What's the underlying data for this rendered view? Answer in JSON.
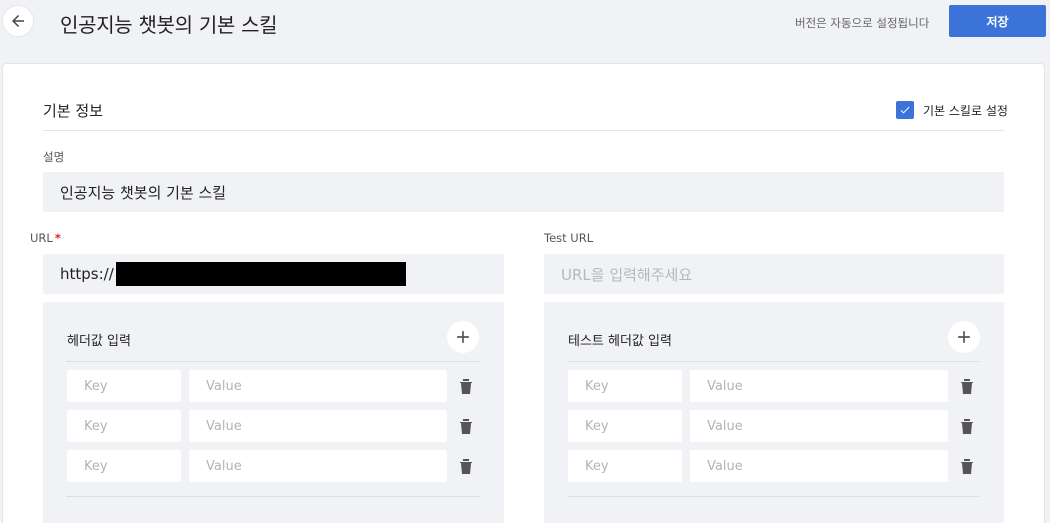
{
  "header": {
    "title": "인공지능 챗봇의 기본 스킬",
    "autosave_note": "버전은 자동으로 설정됩니다",
    "save_label": "저장"
  },
  "basic_info": {
    "section_title": "기본 정보",
    "default_skill_label": "기본 스킬로 설정",
    "default_skill_checked": true,
    "description_label": "설명",
    "description_value": "인공지능 챗봇의 기본 스킬"
  },
  "url": {
    "label": "URL",
    "required_mark": "*",
    "value": "https://"
  },
  "test_url": {
    "label": "Test URL",
    "placeholder": "URL을 입력해주세요"
  },
  "headers": {
    "title": "헤더값 입력",
    "key_placeholder": "Key",
    "value_placeholder": "Value",
    "rows": 3
  },
  "test_headers": {
    "title": "테스트 헤더값 입력",
    "key_placeholder": "Key",
    "value_placeholder": "Value",
    "rows": 3
  },
  "colors": {
    "accent": "#3b73d9",
    "field_bg": "#f1f2f5",
    "required": "#e02020"
  }
}
